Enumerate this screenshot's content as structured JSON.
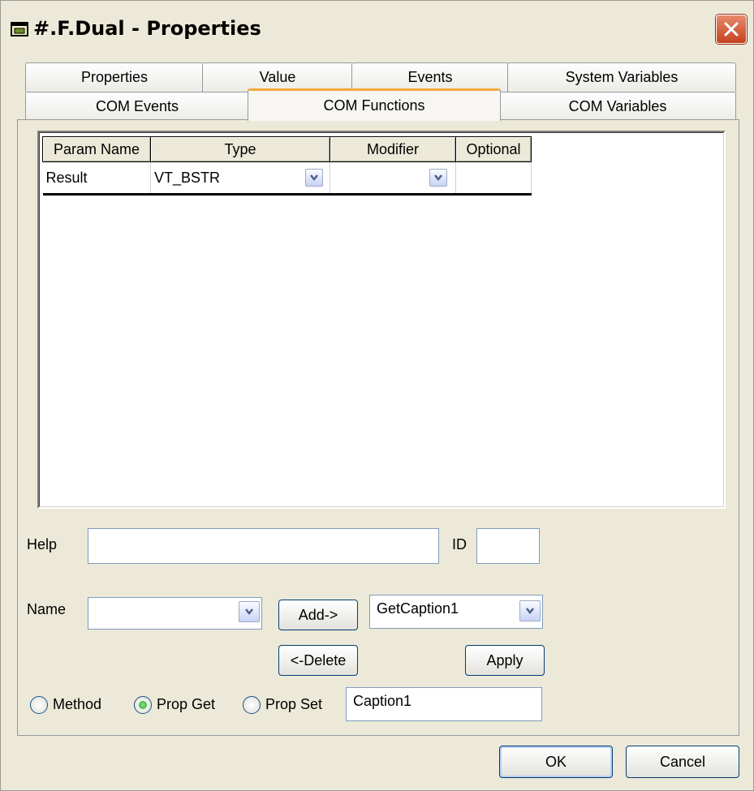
{
  "window": {
    "title": "#.F.Dual - Properties"
  },
  "tabs_row1": [
    "Properties",
    "Value",
    "Events",
    "System Variables"
  ],
  "tabs_row2": [
    "COM Events",
    "COM Functions",
    "COM Variables"
  ],
  "active_tab": "COM Functions",
  "grid": {
    "columns": [
      "Param Name",
      "Type",
      "Modifier",
      "Optional"
    ],
    "rows": [
      {
        "param_name": "Result",
        "type": "VT_BSTR",
        "modifier": "",
        "optional": ""
      }
    ]
  },
  "form": {
    "help_label": "Help",
    "help_value": "",
    "id_label": "ID",
    "id_value": "",
    "name_label": "Name",
    "name_value": "",
    "add_button": "Add->",
    "function_select": "GetCaption1",
    "delete_button": "<-Delete",
    "apply_button": "Apply",
    "radio_method": "Method",
    "radio_prop_get": "Prop Get",
    "radio_prop_set": "Prop Set",
    "selected_radio": "Prop Get",
    "prop_name_value": "Caption1"
  },
  "footer": {
    "ok": "OK",
    "cancel": "Cancel"
  },
  "colors": {
    "dialog_bg": "#ece9d8",
    "active_tab_accent": "#f2a93b",
    "close_button": "#c4421f"
  }
}
